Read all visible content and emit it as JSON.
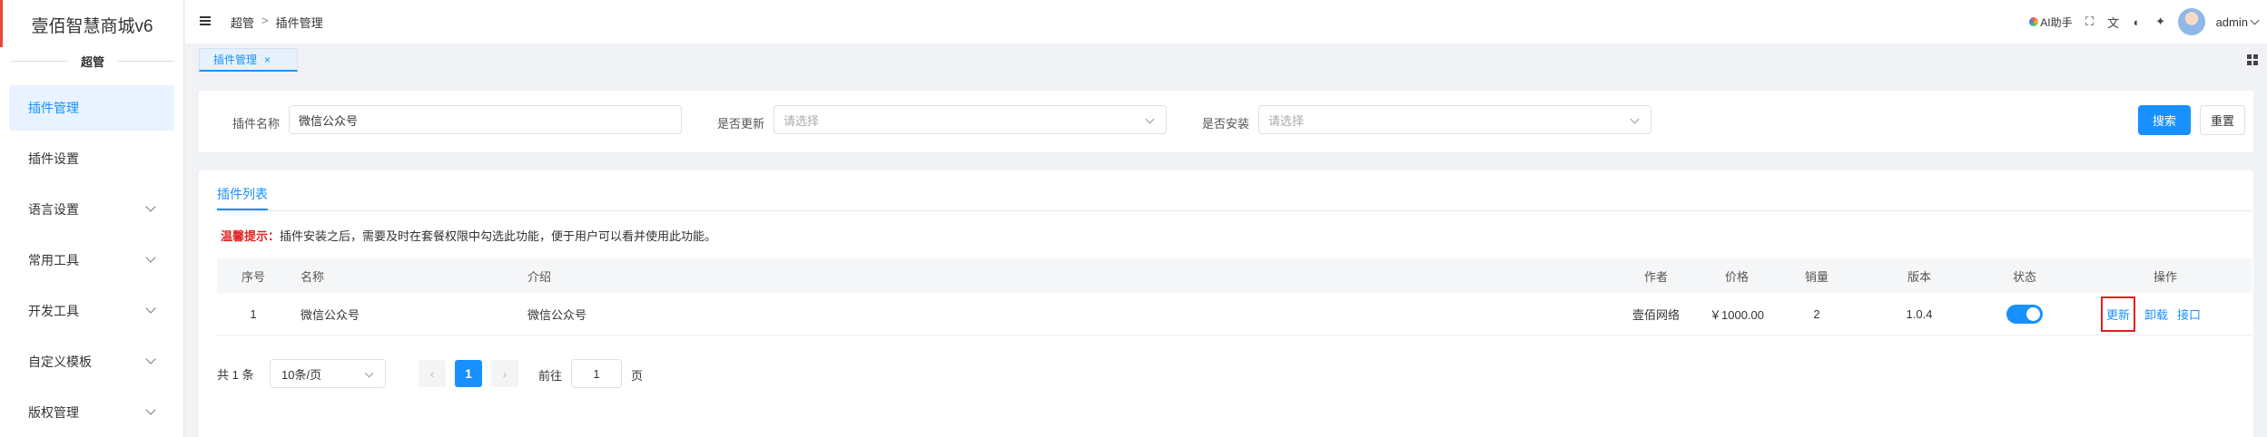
{
  "sidebar": {
    "brand": "壹佰智慧商城v6",
    "group": "超管",
    "items": [
      {
        "label": "插件管理",
        "active": true,
        "expandable": false
      },
      {
        "label": "插件设置",
        "active": false,
        "expandable": false
      },
      {
        "label": "语言设置",
        "active": false,
        "expandable": true
      },
      {
        "label": "常用工具",
        "active": false,
        "expandable": true
      },
      {
        "label": "开发工具",
        "active": false,
        "expandable": true
      },
      {
        "label": "自定义模板",
        "active": false,
        "expandable": true
      },
      {
        "label": "版权管理",
        "active": false,
        "expandable": true
      }
    ]
  },
  "header": {
    "breadcrumb": [
      "超管",
      "插件管理"
    ],
    "breadcrumb_sep": ">",
    "ai_label": "AI助手",
    "username": "admin",
    "icons": [
      "fullscreen-icon",
      "translate-icon",
      "palette-icon",
      "clear-cache-icon"
    ]
  },
  "tabs": [
    {
      "label": "插件管理",
      "close": "×"
    }
  ],
  "search": {
    "name_label": "插件名称",
    "name_value": "微信公众号",
    "update_label": "是否更新",
    "update_placeholder": "请选择",
    "install_label": "是否安装",
    "install_placeholder": "请选择",
    "search_btn": "搜索",
    "reset_btn": "重置"
  },
  "list": {
    "tab": "插件列表",
    "tip_title": "温馨提示：",
    "tip_text": "插件安装之后，需要及时在套餐权限中勾选此功能，便于用户可以看并使用此功能。",
    "columns": [
      "序号",
      "名称",
      "介绍",
      "作者",
      "价格",
      "销量",
      "版本",
      "状态",
      "操作"
    ],
    "rows": [
      {
        "index": "1",
        "name": "微信公众号",
        "intro": "微信公众号",
        "author": "壹佰网络",
        "price": "￥1000.00",
        "sales": "2",
        "version": "1.0.4",
        "status_on": true,
        "actions": [
          "更新",
          "卸载",
          "接口"
        ]
      }
    ]
  },
  "pagination": {
    "total": "共 1 条",
    "page_size": "10条/页",
    "prev": "‹",
    "current": "1",
    "next": "›",
    "goto_label": "前往",
    "goto_value": "1",
    "goto_suffix": "页"
  },
  "colors": {
    "accent": "#1890ff",
    "warn": "#e02424",
    "highlight_border": "#e02020"
  }
}
